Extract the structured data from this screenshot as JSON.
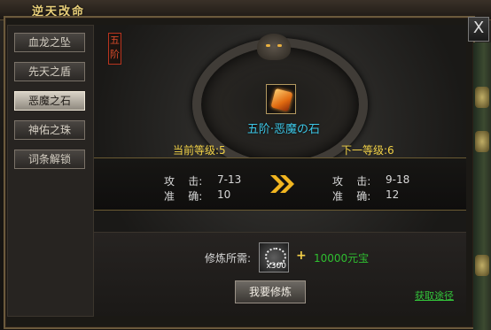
{
  "window": {
    "title": "逆天改命",
    "close_label": "X"
  },
  "sidebar": {
    "items": [
      {
        "label": "血龙之坠",
        "active": false
      },
      {
        "label": "先天之盾",
        "active": false
      },
      {
        "label": "恶魔之石",
        "active": true
      },
      {
        "label": "神佑之珠",
        "active": false
      },
      {
        "label": "词条解锁",
        "active": false
      }
    ]
  },
  "item": {
    "tier_badge": "五阶",
    "name": "五阶·恶魔の石",
    "icon": "demon-stone-icon"
  },
  "current": {
    "label": "当前等级:5",
    "attack_name": "攻    击:",
    "attack_value": "7-13",
    "accuracy_name": "准    确:",
    "accuracy_value": "10"
  },
  "next": {
    "label": "下一等级:6",
    "attack_name": "攻    击:",
    "attack_value": "9-18",
    "accuracy_name": "准    确:",
    "accuracy_value": "12"
  },
  "requirement": {
    "label": "修炼所需:",
    "material_count": "x300",
    "plus": "+",
    "gold": "10000元宝"
  },
  "actions": {
    "refine_label": "我要修炼",
    "get_label": "获取途径"
  },
  "colors": {
    "accent_gold": "#f1d146",
    "item_name": "#3ec8e8",
    "green": "#2fbf30",
    "badge_red": "#d54a2a"
  }
}
